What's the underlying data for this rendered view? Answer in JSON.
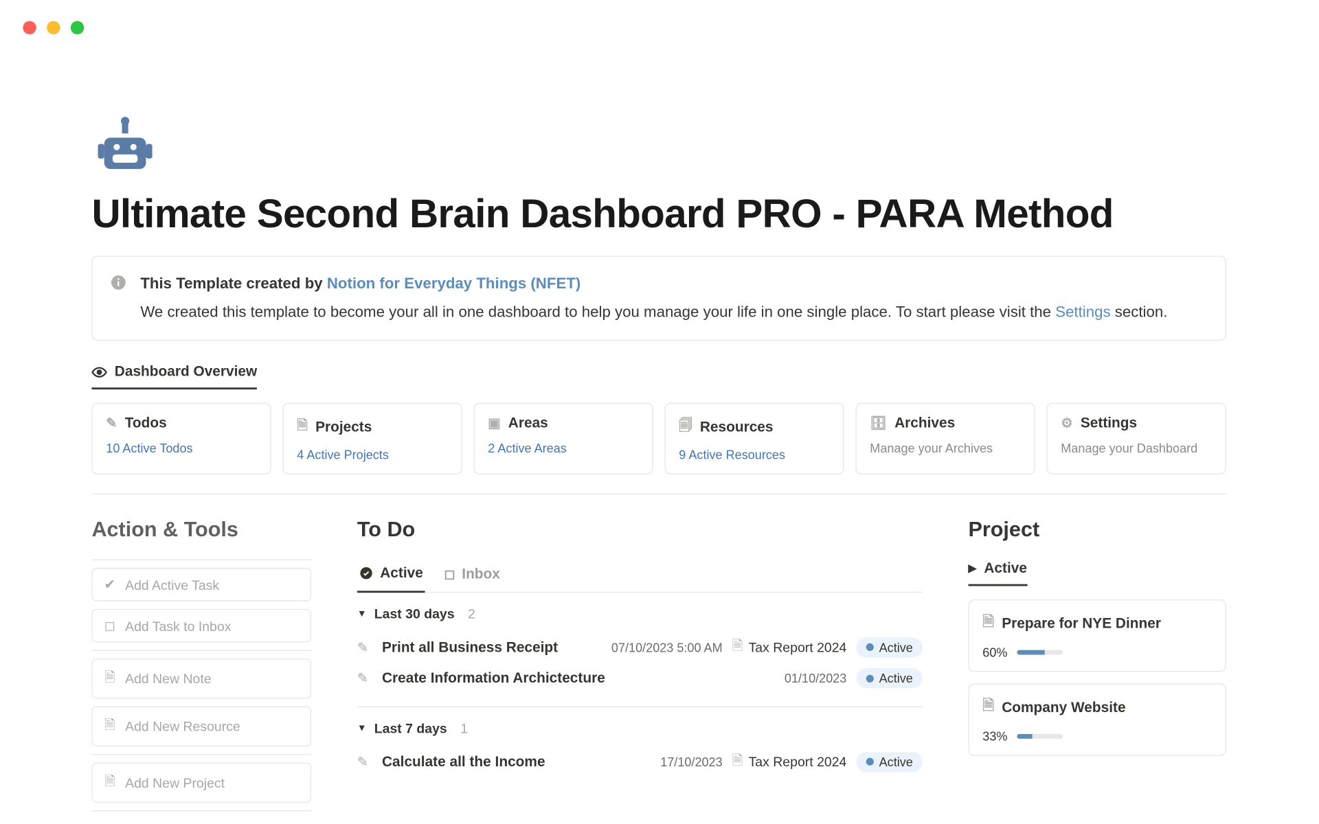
{
  "page": {
    "title": "Ultimate Second Brain Dashboard PRO - PARA Method"
  },
  "callout": {
    "line1_prefix": "This Template created by ",
    "author_link": "Notion for Everyday Things (NFET)",
    "line2_before": "We created this template to become your all in one dashboard to help you manage your life in one single place. To start please visit the ",
    "line2_link": "Settings",
    "line2_after": " section."
  },
  "overview_tab": "Dashboard Overview",
  "cards": [
    {
      "icon": "pen",
      "title": "Todos",
      "sub": "10 Active Todos",
      "sub_gray": false
    },
    {
      "icon": "page",
      "title": "Projects",
      "sub": "4 Active Projects",
      "sub_gray": false
    },
    {
      "icon": "area",
      "title": "Areas",
      "sub": "2 Active Areas",
      "sub_gray": false
    },
    {
      "icon": "resource",
      "title": "Resources",
      "sub": "9 Active Resources",
      "sub_gray": false
    },
    {
      "icon": "archive",
      "title": "Archives",
      "sub": "Manage your Archives",
      "sub_gray": true
    },
    {
      "icon": "gear",
      "title": "Settings",
      "sub": "Manage your Dashboard",
      "sub_gray": true
    }
  ],
  "left": {
    "heading": "Action & Tools",
    "groups": [
      [
        {
          "icon": "check",
          "label": "Add Active Task"
        },
        {
          "icon": "inbox",
          "label": "Add Task to Inbox"
        }
      ],
      [
        {
          "icon": "page",
          "label": "Add New Note"
        },
        {
          "icon": "page",
          "label": "Add New Resource"
        }
      ],
      [
        {
          "icon": "page",
          "label": "Add New Project"
        }
      ]
    ]
  },
  "mid": {
    "heading": "To Do",
    "tabs": [
      {
        "icon": "check-circle",
        "label": "Active",
        "active": true
      },
      {
        "icon": "inbox",
        "label": "Inbox",
        "active": false
      }
    ],
    "groups": [
      {
        "label": "Last 30 days",
        "count": "2",
        "rows": [
          {
            "title": "Print all Business Receipt",
            "date": "07/10/2023 5:00 AM",
            "project": "Tax Report 2024",
            "status": "Active"
          },
          {
            "title": "Create Information Archictecture",
            "date": "01/10/2023",
            "project": "",
            "status": "Active"
          }
        ]
      },
      {
        "label": "Last 7 days",
        "count": "1",
        "rows": [
          {
            "title": "Calculate all the Income",
            "date": "17/10/2023",
            "project": "Tax Report 2024",
            "status": "Active"
          }
        ]
      }
    ]
  },
  "right": {
    "heading": "Project",
    "tab": "Active",
    "projects": [
      {
        "title": "Prepare for NYE Dinner",
        "pct": "60%",
        "pct_val": 60
      },
      {
        "title": "Company Website",
        "pct": "33%",
        "pct_val": 33
      }
    ]
  }
}
